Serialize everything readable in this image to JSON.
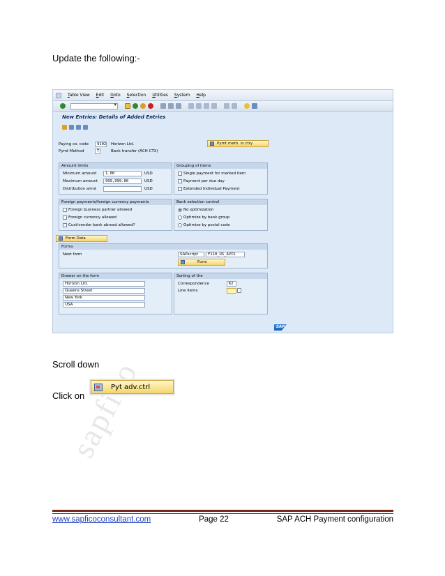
{
  "heading": "Update the following:-",
  "sap": {
    "menu": [
      "Table View",
      "Edit",
      "Goto",
      "Selection",
      "Utilities",
      "System",
      "Help"
    ],
    "title": "New Entries: Details of Added Entries",
    "paying_co_label": "Paying co. code",
    "paying_co_value": "9102",
    "paying_co_name": "Horizon Ltd.",
    "pymt_method_label": "Pymt Method",
    "pymt_method_value": "T",
    "pymt_method_name": "Bank transfer (ACH CTX)",
    "pymt_meth_btn": "Pymt meth. in ctry",
    "amount_limits": {
      "header": "Amount limits",
      "min_label": "Minimum amount",
      "min_value": "1.00",
      "max_label": "Maximum amount",
      "max_value": "999,999.00",
      "dist_label": "Distribution amnt",
      "dist_value": "",
      "currency": "USD"
    },
    "grouping": {
      "header": "Grouping of items",
      "items": [
        "Single payment for marked item",
        "Payment per due day",
        "Extended Individual Payment"
      ]
    },
    "foreign": {
      "header": "Foreign payments/foreign currency payments",
      "items": [
        "Foreign business partner allowed",
        "Foreign currency allowed",
        "Cust/vendor bank abroad allowed?"
      ]
    },
    "bank_sel": {
      "header": "Bank selection control",
      "items": [
        "No optimization",
        "Optimize by bank group",
        "Optimize by postal code"
      ]
    },
    "form_data_btn": "Form Data",
    "forms": {
      "header": "Forms",
      "next_form_label": "Next form",
      "script_type": "SAPscript",
      "form_name": "F110_US_AVIS",
      "form_btn": "Form"
    },
    "drawer": {
      "header": "Drawer on the form",
      "lines": [
        "Horizon Ltd.",
        "Queens Street",
        "New York",
        "USA"
      ]
    },
    "sorting": {
      "header": "Sorting of the",
      "corr_label": "Correspondence",
      "corr_value": "K2",
      "line_label": "Line items",
      "line_value": ""
    },
    "logo": "SAP"
  },
  "scroll_text": "Scroll down",
  "click_text": "Click on",
  "pyt_btn_label": "Pyt adv.ctrl",
  "watermark": "sapfico",
  "footer": {
    "link": "www.sapficoconsultant.com",
    "page": "Page 22",
    "title": "SAP ACH Payment configuration"
  },
  "colors": {
    "sap_bg": "#dde9f6",
    "button_yellow": "#f5d66a",
    "footer_rule": "#7a2a18",
    "link": "#1f3fbf"
  }
}
